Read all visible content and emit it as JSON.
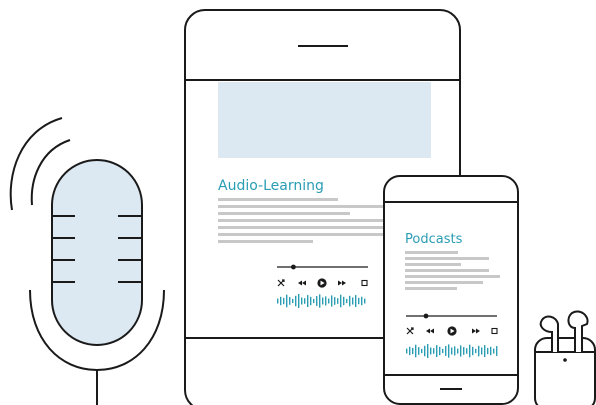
{
  "tablet": {
    "title": "Audio-Learning",
    "player": {
      "progress": 0.18,
      "controls": [
        "shuffle-icon",
        "rewind-icon",
        "play-icon",
        "forward-icon",
        "stop-icon"
      ]
    }
  },
  "phone": {
    "title": "Podcasts",
    "player": {
      "progress": 0.22,
      "controls": [
        "shuffle-icon",
        "rewind-icon",
        "play-icon",
        "forward-icon",
        "stop-icon"
      ]
    }
  },
  "colors": {
    "accent": "#2a9db4",
    "screen_fill": "#dce8f2",
    "line": "#1a1a1a",
    "text_placeholder": "#c8c8c8"
  }
}
